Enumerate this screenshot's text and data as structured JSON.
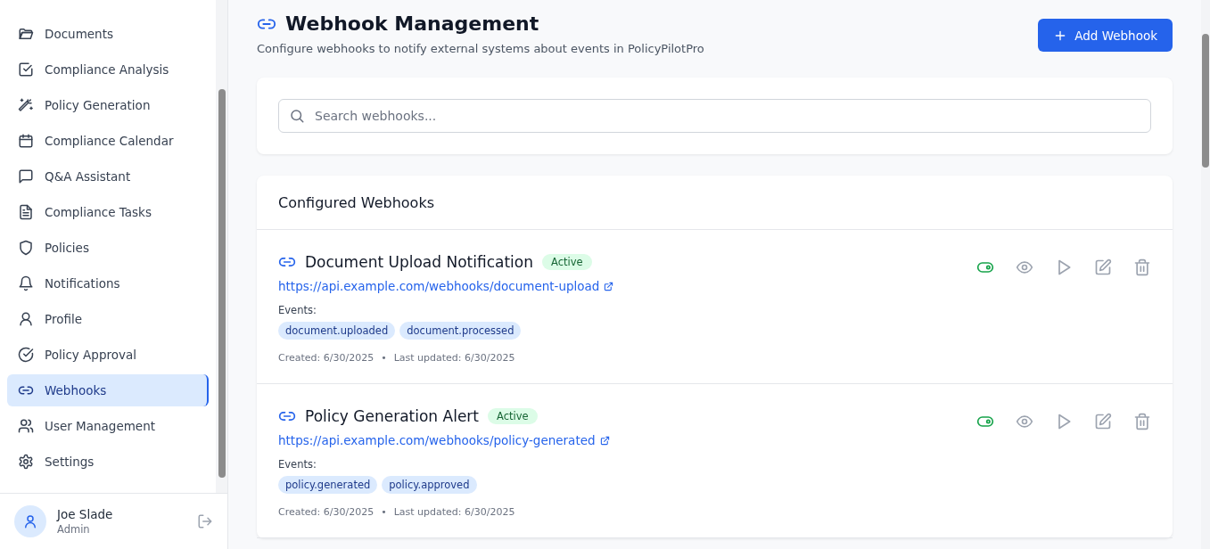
{
  "sidebar": {
    "items": [
      {
        "label": "Documents",
        "selected": false
      },
      {
        "label": "Compliance Analysis",
        "selected": false
      },
      {
        "label": "Policy Generation",
        "selected": false
      },
      {
        "label": "Compliance Calendar",
        "selected": false
      },
      {
        "label": "Q&A Assistant",
        "selected": false
      },
      {
        "label": "Compliance Tasks",
        "selected": false
      },
      {
        "label": "Policies",
        "selected": false
      },
      {
        "label": "Notifications",
        "selected": false
      },
      {
        "label": "Profile",
        "selected": false
      },
      {
        "label": "Policy Approval",
        "selected": false
      },
      {
        "label": "Webhooks",
        "selected": true
      },
      {
        "label": "User Management",
        "selected": false
      },
      {
        "label": "Settings",
        "selected": false
      }
    ],
    "user": {
      "name": "Joe Slade",
      "role": "Admin"
    }
  },
  "header": {
    "title": "Webhook Management",
    "subtitle": "Configure webhooks to notify external systems about events in PolicyPilotPro",
    "add_button": "Add Webhook"
  },
  "search": {
    "placeholder": "Search webhooks..."
  },
  "webhooks": {
    "title": "Configured Webhooks",
    "items": [
      {
        "name": "Document Upload Notification",
        "status": "Active",
        "enabled": true,
        "url": "https://api.example.com/webhooks/document-upload",
        "events_label": "Events:",
        "events": [
          "document.uploaded",
          "document.processed"
        ],
        "created": "Created: 6/30/2025",
        "separator": "•",
        "updated": "Last updated: 6/30/2025"
      },
      {
        "name": "Policy Generation Alert",
        "status": "Active",
        "enabled": true,
        "url": "https://api.example.com/webhooks/policy-generated",
        "events_label": "Events:",
        "events": [
          "policy.generated",
          "policy.approved"
        ],
        "created": "Created: 6/30/2025",
        "separator": "•",
        "updated": "Last updated: 6/30/2025"
      }
    ]
  }
}
